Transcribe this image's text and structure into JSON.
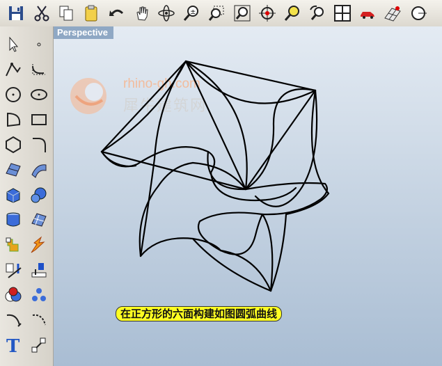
{
  "toolbar": {
    "items": [
      {
        "name": "save-icon"
      },
      {
        "name": "cut-icon"
      },
      {
        "name": "copy-icon"
      },
      {
        "name": "paste-icon"
      },
      {
        "name": "undo-icon"
      },
      {
        "name": "pan-hand-icon"
      },
      {
        "name": "rotate-view-icon"
      },
      {
        "name": "zoom-in-out-icon"
      },
      {
        "name": "zoom-window-icon"
      },
      {
        "name": "zoom-extents-icon"
      },
      {
        "name": "zoom-target-icon"
      },
      {
        "name": "zoom-selected-icon"
      },
      {
        "name": "undo-view-icon"
      },
      {
        "name": "four-viewports-icon"
      },
      {
        "name": "car-render-icon"
      },
      {
        "name": "grid-plane-icon"
      },
      {
        "name": "osnap-icon"
      }
    ]
  },
  "viewport": {
    "title": "Perspective",
    "watermark_url": "rhino-gh.com",
    "watermark_cn": "犀牛建筑网",
    "caption": "在正方形的六面构建如图圆弧曲线"
  },
  "colors": {
    "viewport_top": "#e4ebf3",
    "viewport_bottom": "#a9bdd3",
    "title_bg": "#8fa8c4",
    "caption_bg": "#ffff22"
  }
}
